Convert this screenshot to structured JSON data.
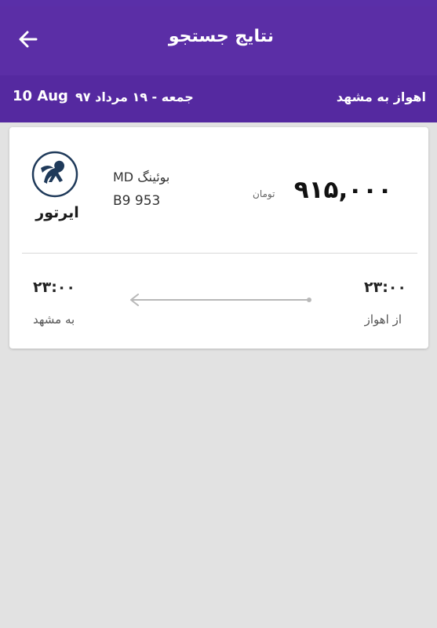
{
  "header": {
    "title": "نتایج جستجو",
    "back_icon": "arrow-left-icon"
  },
  "subheader": {
    "route": "اهواز به مشهد",
    "date_fa": "جمعه - ۱۹ مرداد ۹۷",
    "date_en": "10 Aug"
  },
  "flight": {
    "airline": "ایرتور",
    "airline_logo": "pegasus-logo-icon",
    "aircraft": "بوئینگ MD",
    "flight_number": "B9 953",
    "price": "۹۱۵,۰۰۰",
    "currency": "تومان",
    "departure_time": "۲۳:۰۰",
    "arrival_time": "۲۳:۰۰",
    "from_label": "از اهواز",
    "to_label": "به مشهد",
    "direction_icon": "arrow-left-line-icon"
  },
  "colors": {
    "primary": "#5b2ea6",
    "primary_dark": "#5529a0",
    "background": "#e2e2e2",
    "card": "#ffffff"
  }
}
